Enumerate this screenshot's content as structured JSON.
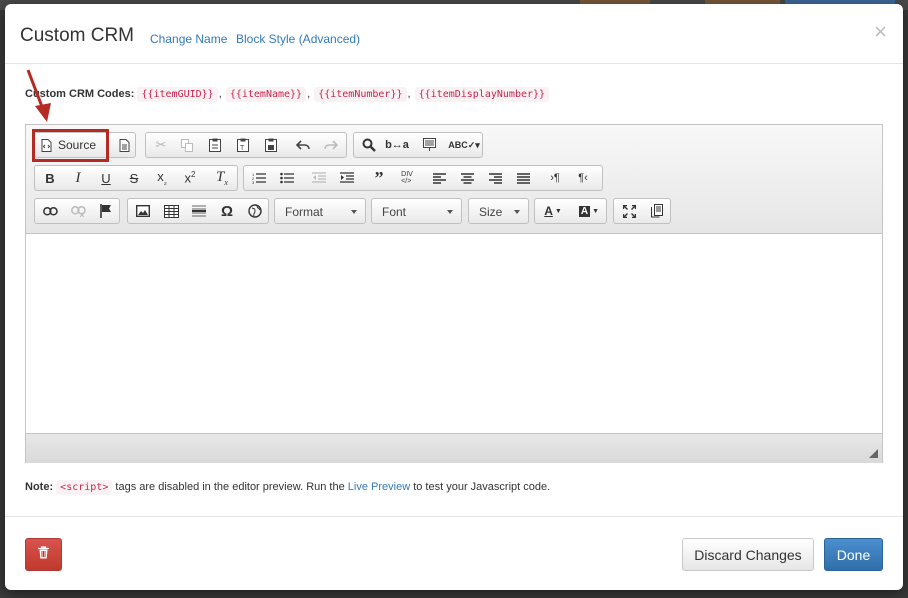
{
  "modal": {
    "title": "Custom CRM",
    "change_name_link": "Change Name",
    "block_style_link": "Block Style (Advanced)",
    "close_symbol": "×"
  },
  "codes": {
    "label": "Custom CRM Codes:",
    "items": [
      "{{itemGUID}}",
      "{{itemName}}",
      "{{itemNumber}}",
      "{{itemDisplayNumber}}"
    ],
    "separator": ","
  },
  "toolbar": {
    "source_label": "Source",
    "format_label": "Format",
    "font_label": "Font",
    "size_label": "Size"
  },
  "note": {
    "label": "Note:",
    "code": "<script>",
    "text_before": "tags are disabled in the editor preview. Run the",
    "link": "Live Preview",
    "text_after": "to test your Javascript code."
  },
  "footer": {
    "discard_label": "Discard Changes",
    "done_label": "Done"
  },
  "colors": {
    "highlight": "#b52a22",
    "link": "#337ab7",
    "code_text": "#c7254e",
    "danger": "#c9302c",
    "primary": "#337ab7"
  }
}
